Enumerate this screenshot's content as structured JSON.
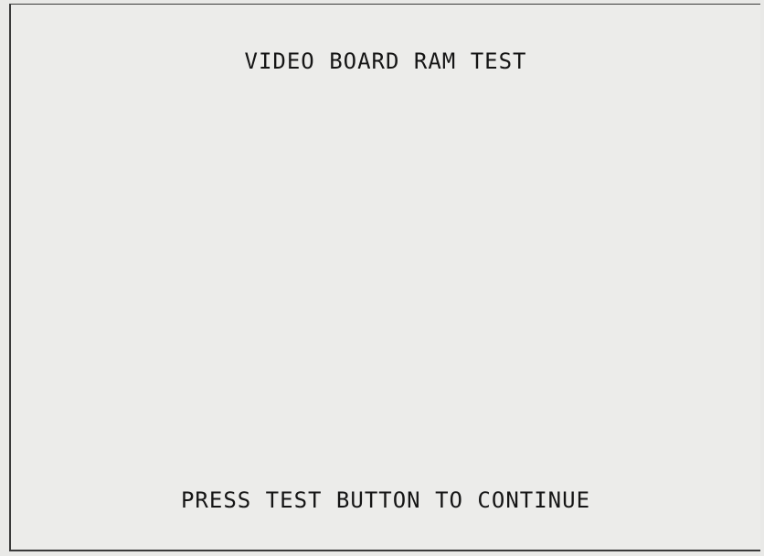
{
  "screen": {
    "title": "VIDEO BOARD RAM TEST",
    "prompt": "PRESS TEST BUTTON TO CONTINUE"
  }
}
